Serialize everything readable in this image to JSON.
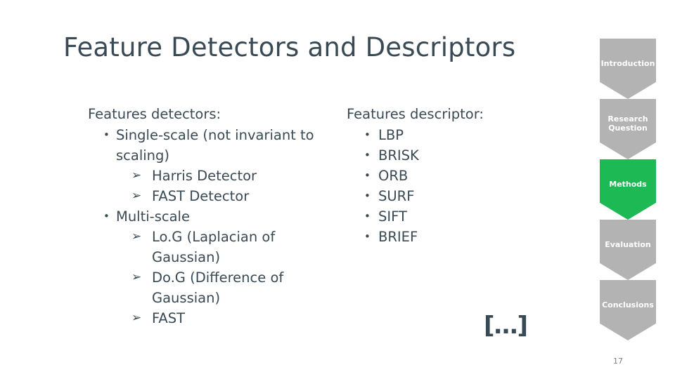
{
  "slide": {
    "title": "Feature Detectors and Descriptors",
    "page_number": "17",
    "ellipsis": "[…]"
  },
  "left_column": {
    "heading": "Features detectors:",
    "items": [
      {
        "bullet": "•",
        "text": "Single-scale (not invariant to scaling)",
        "sub": [
          {
            "marker": "➢",
            "text": "Harris Detector"
          },
          {
            "marker": "➢",
            "text": "FAST Detector"
          }
        ]
      },
      {
        "bullet": "•",
        "text": "Multi-scale",
        "sub": [
          {
            "marker": "➢",
            "text": "Lo.G (Laplacian of Gaussian)"
          },
          {
            "marker": "➢",
            "text": "Do.G (Difference of Gaussian)"
          },
          {
            "marker": "➢",
            "text": "FAST"
          }
        ]
      }
    ]
  },
  "right_column": {
    "heading": "Features descriptor:",
    "items": [
      {
        "bullet": "•",
        "text": "LBP"
      },
      {
        "bullet": "•",
        "text": "BRISK"
      },
      {
        "bullet": "•",
        "text": "ORB"
      },
      {
        "bullet": "•",
        "text": "SURF"
      },
      {
        "bullet": "•",
        "text": "SIFT"
      },
      {
        "bullet": "•",
        "text": "BRIEF"
      }
    ]
  },
  "nav": {
    "active_color": "#1db954",
    "inactive_color": "#b3b3b3",
    "items": [
      {
        "label": "Introduction",
        "active": false
      },
      {
        "label": "Research Question",
        "active": false
      },
      {
        "label": "Methods",
        "active": true
      },
      {
        "label": "Evaluation",
        "active": false
      },
      {
        "label": "Conclusions",
        "active": false
      }
    ]
  }
}
